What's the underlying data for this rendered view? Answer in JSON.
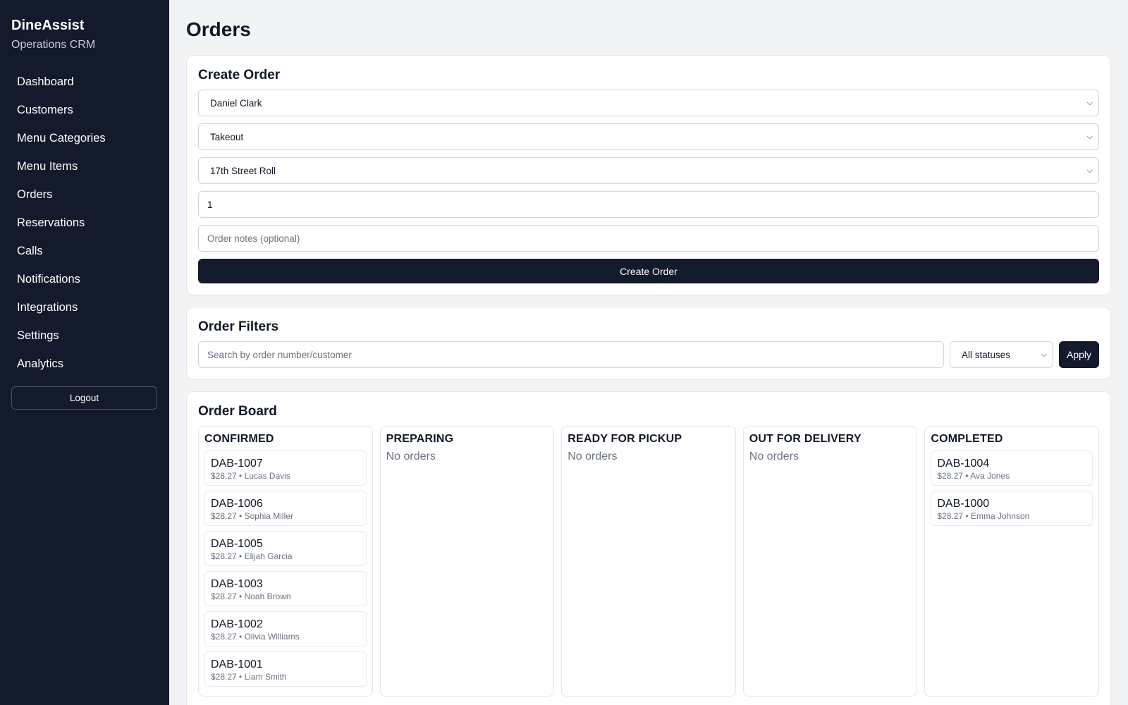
{
  "sidebar": {
    "brand_title": "DineAssist",
    "brand_subtitle": "Operations CRM",
    "items": [
      {
        "label": "Dashboard"
      },
      {
        "label": "Customers"
      },
      {
        "label": "Menu Categories"
      },
      {
        "label": "Menu Items"
      },
      {
        "label": "Orders"
      },
      {
        "label": "Reservations"
      },
      {
        "label": "Calls"
      },
      {
        "label": "Notifications"
      },
      {
        "label": "Integrations"
      },
      {
        "label": "Settings"
      },
      {
        "label": "Analytics"
      }
    ],
    "logout_label": "Logout"
  },
  "page": {
    "title": "Orders"
  },
  "create_order": {
    "title": "Create Order",
    "customer_value": "Daniel Clark",
    "type_value": "Takeout",
    "item_value": "17th Street Roll",
    "quantity_value": "1",
    "notes_placeholder": "Order notes (optional)",
    "submit_label": "Create Order"
  },
  "filters": {
    "title": "Order Filters",
    "search_placeholder": "Search by order number/customer",
    "status_value": "All statuses",
    "apply_label": "Apply"
  },
  "board": {
    "title": "Order Board",
    "empty_label": "No orders",
    "columns": [
      {
        "title": "CONFIRMED",
        "orders": [
          {
            "number": "DAB-1007",
            "meta": "$28.27 • Lucas Davis"
          },
          {
            "number": "DAB-1006",
            "meta": "$28.27 • Sophia Miller"
          },
          {
            "number": "DAB-1005",
            "meta": "$28.27 • Elijah Garcia"
          },
          {
            "number": "DAB-1003",
            "meta": "$28.27 • Noah Brown"
          },
          {
            "number": "DAB-1002",
            "meta": "$28.27 • Olivia Williams"
          },
          {
            "number": "DAB-1001",
            "meta": "$28.27 • Liam Smith"
          }
        ]
      },
      {
        "title": "PREPARING",
        "empty": "No orders"
      },
      {
        "title": "READY FOR PICKUP",
        "empty": "No orders"
      },
      {
        "title": "OUT FOR DELIVERY",
        "empty": "No orders"
      },
      {
        "title": "COMPLETED",
        "orders": [
          {
            "number": "DAB-1004",
            "meta": "$28.27 • Ava Jones"
          },
          {
            "number": "DAB-1000",
            "meta": "$28.27 • Emma Johnson"
          }
        ]
      }
    ]
  },
  "icons": {
    "select_chevron": "chevron-down-icon"
  }
}
